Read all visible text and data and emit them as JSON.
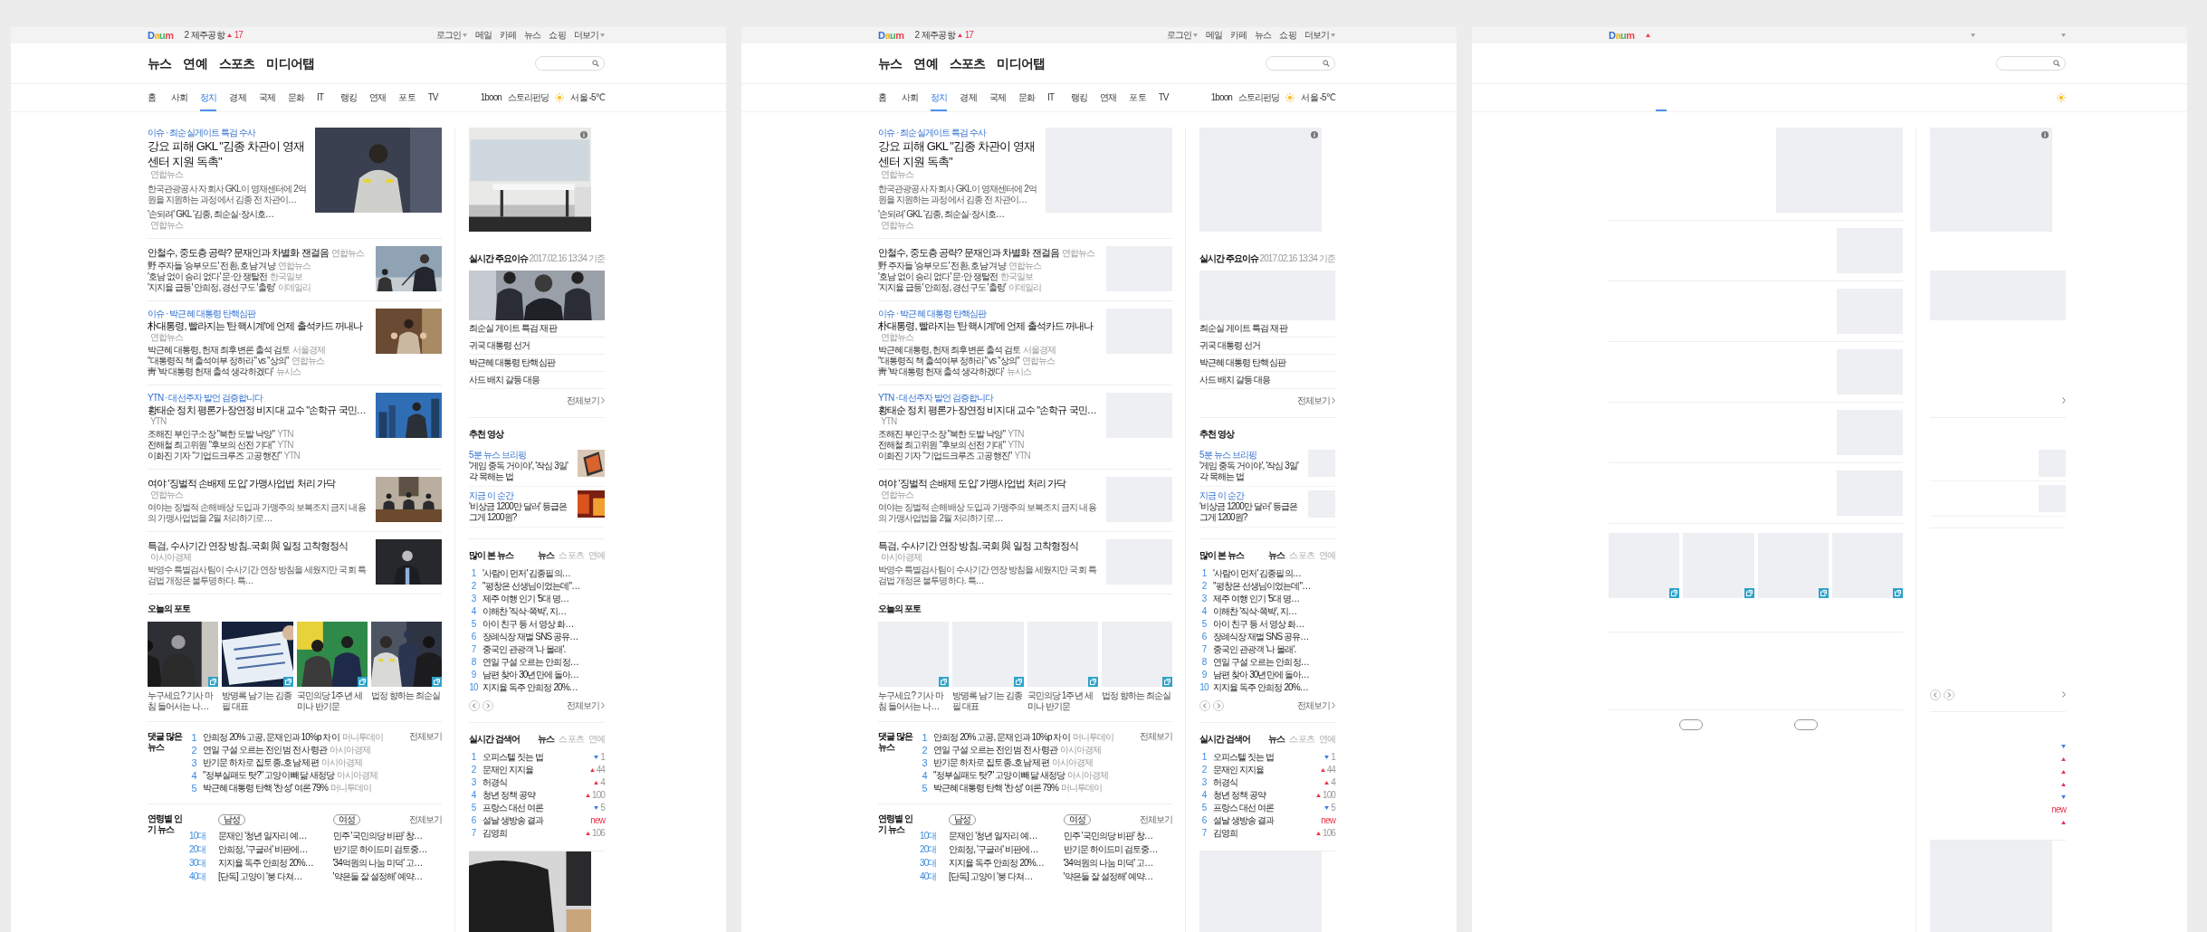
{
  "panels": [
    {
      "topbar": {
        "logo": "Daum",
        "hot": {
          "rank": "2",
          "keyword": "제주공항",
          "kind": "up",
          "change": "17"
        },
        "links": [
          {
            "label": "로그인",
            "dropdown": true
          },
          {
            "label": "메일",
            "dropdown": false
          },
          {
            "label": "카페",
            "dropdown": false
          },
          {
            "label": "뉴스",
            "dropdown": false
          },
          {
            "label": "쇼핑",
            "dropdown": false
          },
          {
            "label": "더보기",
            "dropdown": true
          }
        ]
      },
      "sections": [
        {
          "label": "뉴스"
        },
        {
          "label": "연예"
        },
        {
          "label": "스포츠"
        },
        {
          "label": "미디어탭"
        }
      ],
      "nav": [
        {
          "label": "홈",
          "selected": false
        },
        {
          "label": "사회",
          "selected": false
        },
        {
          "label": "정치",
          "selected": true
        },
        {
          "label": "경제",
          "selected": false
        },
        {
          "label": "국제",
          "selected": false
        },
        {
          "label": "문화",
          "selected": false
        },
        {
          "label": "IT",
          "selected": false
        },
        {
          "label": "랭킹",
          "selected": false
        },
        {
          "label": "연재",
          "selected": false
        },
        {
          "label": "포토",
          "selected": false
        },
        {
          "label": "TV",
          "selected": false
        }
      ],
      "nav_extra": {
        "links": [
          "1boon",
          "스토리펀딩"
        ],
        "weather": "서울 -5℃"
      },
      "articles": [
        {
          "kind": "lead",
          "tag": "이슈 · 최순실게이트 특검 수사",
          "headline": "강요 피해 GKL \"김종 차관이 영재센터 지원 독촉\"",
          "source": "연합뉴스",
          "summary": "한국관광공사 자회사 GKL이 영재센터에 2억원을 지원하는 과정에서 김종 전 차관이…",
          "related": [
            {
              "text": "'손되려' GKL '김종, 최순실·장시호…",
              "source": "연합뉴스"
            }
          ]
        },
        {
          "kind": "standard",
          "headline": "안철수, 중도층 공략? 문재인과 차별화 잰걸음",
          "source": "연합뉴스",
          "related": [
            {
              "text": "野 주자들 '승부모드' 전환, 호남 겨냥",
              "source": "연합뉴스"
            },
            {
              "text": "'호남 없이 승리 없다' 문·안 쟁탈전",
              "source": "한국일보"
            },
            {
              "text": "'지지율 급등' 안희정, 경선구도 '출렁'",
              "source": "이데일리"
            }
          ]
        },
        {
          "kind": "standard",
          "tag": "이슈 · 박근혜 대통령 탄핵심판",
          "headline": "朴대통령, 빨라지는 '탄핵시계'에 언제 출석카드 꺼내나",
          "source": "연합뉴스",
          "related": [
            {
              "text": "박근혜 대통령, 헌재 최후변론 출석 검토",
              "source": "서울경제"
            },
            {
              "text": "\"대통령직 책 출석여부 정하라\" vs \"상의\"",
              "source": "연합뉴스"
            },
            {
              "text": "靑 '박 대통령 헌재 출석 생각하겠다'",
              "source": "뉴시스"
            }
          ]
        },
        {
          "kind": "standard",
          "tag": "YTN · 대선주자 발언 검증합니다",
          "headline": "황태순 정치 평론가·장연정 비지대 교수 \"손학규 국민…",
          "source": "YTN",
          "related": [
            {
              "text": "조해진 부인구소장 \"북한 도발 낙양\"",
              "source": "YTN"
            },
            {
              "text": "전해철 최고위원 \"후보의 선전 기대\"",
              "source": "YTN"
            },
            {
              "text": "이화진 기자 \"기업드크루즈 고공행진\"",
              "source": "YTN"
            }
          ]
        },
        {
          "kind": "standard",
          "headline": "여야 '징벌적 손배제 도입' 가맹사업법 처리 가닥",
          "source": "연합뉴스",
          "summary": "여야는 징벌적 손해배상 도입과 가맹주의 보복조치 금지 내용의 가맹사업법을 2월 처리하기로…"
        },
        {
          "kind": "standard",
          "headline": "특검, 수사기간 연장 방침..국회 與 일정 고착형정식",
          "source": "아시아경제",
          "summary": "박영수 특별검사팀이 수사기간 연장 방침을 세웠지만 국회 특검법 개정은 불투명하다. 특…"
        }
      ],
      "photos": {
        "title": "오늘의 포토",
        "items": [
          {
            "kind": "picture",
            "caption": "누구세요? 기사 마침 들어서는 나…"
          },
          {
            "kind": "picture",
            "caption": "방명록 남기는 김종필 대표"
          },
          {
            "kind": "picture",
            "caption": "국민의당 1주년 세미나 반기문"
          },
          {
            "kind": "picture",
            "caption": "법정 향하는 최순실"
          }
        ]
      },
      "comments": {
        "title": "댓글 많은 뉴스",
        "more": "전체보기",
        "items": [
          {
            "rank": "1",
            "text": "안희정 20% 고공, 문재인과 10%p 차이",
            "source": "머니투데이"
          },
          {
            "rank": "2",
            "text": "연일 구설 오르는 전인범 전 사령관",
            "source": "아시아경제"
          },
          {
            "rank": "3",
            "text": "반기문 하차로 집토종..호남 제편",
            "source": "아시아경제"
          },
          {
            "rank": "4",
            "text": "\"정부실패도 탓?\" 고양이 빼닮 새정당",
            "source": "아시아경제"
          },
          {
            "rank": "5",
            "text": "박근혜 대통령 탄핵 '찬성' 여론 79%",
            "source": "머니투데이"
          }
        ]
      },
      "age_news": {
        "title": "연령별 인기 뉴스",
        "more": "전체보기",
        "tabs": [
          {
            "kind": "pill",
            "label": "남성"
          },
          {
            "kind": "pill",
            "label": "여성"
          }
        ],
        "rows": [
          {
            "age": "10대",
            "male": "문재인 '청년 일자리 예…",
            "female": "민주 '국민의당 비판' 창…"
          },
          {
            "age": "20대",
            "male": "안희정, '구글러' 비판에…",
            "female": "반기문 하이드미 검토중…"
          },
          {
            "age": "30대",
            "male": "지지율 독주 안희정 20%…",
            "female": "'34억원의 나눔 미덕' 고…"
          },
          {
            "age": "40대",
            "male": "[단독] 고양이 '붕 다쳐…",
            "female": "'약은둘 잘 설정해' 예약…"
          }
        ]
      },
      "sidebar": {
        "issue": {
          "title": "실시간 주요이슈",
          "time": "2017.02.16 13:34 기준",
          "items": [
            "최순실 게이트 특검 재판",
            "귀국 대통령 선거",
            "박근혜 대통령 탄핵심판",
            "사드 배치 갈등 대응"
          ],
          "more": "전체보기"
        },
        "recommend": {
          "title": "추천 영상",
          "items": [
            {
              "kind": "picture",
              "tag": "5분 뉴스 브리핑",
              "text": "'게임 중독 거이야', '작심 3일' 각 목해는 법"
            },
            {
              "kind": "picture",
              "tag": "지금 이 순간",
              "text": "'비상금 1200만 달러' 등급은 그게 1200원?"
            }
          ]
        },
        "most_viewed": {
          "title": "많이 본 뉴스",
          "tabs": [
            {
              "label": "뉴스",
              "selected": true
            },
            {
              "label": "스포츠",
              "selected": false
            },
            {
              "label": "연예",
              "selected": false
            }
          ],
          "items": [
            {
              "rank": "1",
              "text": "'사람이 먼저' 김종필의…"
            },
            {
              "rank": "2",
              "text": "\"평창은 선생님이었는데\"…"
            },
            {
              "rank": "3",
              "text": "제주 여행 인기 '5대 명…"
            },
            {
              "rank": "4",
              "text": "이해찬 '직삭·쪽박', 지…"
            },
            {
              "rank": "5",
              "text": "아이 친구 등 서 영상 화…"
            },
            {
              "rank": "6",
              "text": "장례식장 재벌 SNS 공유…"
            },
            {
              "rank": "7",
              "text": "중국인 관광객 '나 몰래'."
            },
            {
              "rank": "8",
              "text": "연일 구설 오르는 안희정…"
            },
            {
              "rank": "9",
              "text": "남편 찾아 30년만에 돌아…"
            },
            {
              "rank": "10",
              "text": "지지율 독주 안희정 20%…"
            }
          ],
          "more": "전체보기"
        },
        "realtime": {
          "title": "실시간 검색어",
          "tabs": [
            {
              "label": "뉴스",
              "selected": true
            },
            {
              "label": "스포츠",
              "selected": false
            },
            {
              "label": "연예",
              "selected": false
            }
          ],
          "items": [
            {
              "rank": "1",
              "keyword": "오피스텔 짓는 법",
              "kind": "down",
              "change": "1"
            },
            {
              "rank": "2",
              "keyword": "문재인 지지율",
              "kind": "up",
              "change": "44"
            },
            {
              "rank": "3",
              "keyword": "허경식",
              "kind": "up",
              "change": "4"
            },
            {
              "rank": "4",
              "keyword": "청년 정책 공약",
              "kind": "up",
              "change": "100"
            },
            {
              "rank": "5",
              "keyword": "프랑스 대선 여론",
              "kind": "down",
              "change": "5"
            },
            {
              "rank": "6",
              "keyword": "설날 생방송 결과",
              "kind": "new",
              "change": "new"
            },
            {
              "rank": "7",
              "keyword": "김영희",
              "kind": "up",
              "change": "106"
            }
          ]
        }
      }
    },
    {
      "kind": "placeholder",
      "topbar": {
        "logo": "Daum",
        "hot": {
          "rank": "2",
          "keyword": "제주공항",
          "kind": "up",
          "change": "17"
        },
        "links": [
          {
            "label": "로그인",
            "dropdown": true
          },
          {
            "label": "메일",
            "dropdown": false
          },
          {
            "label": "카페",
            "dropdown": false
          },
          {
            "label": "뉴스",
            "dropdown": false
          },
          {
            "label": "쇼핑",
            "dropdown": false
          },
          {
            "label": "더보기",
            "dropdown": true
          }
        ]
      },
      "sections": [
        {
          "label": "뉴스"
        },
        {
          "label": "연예"
        },
        {
          "label": "스포츠"
        },
        {
          "label": "미디어탭"
        }
      ],
      "nav": [
        {
          "label": "홈",
          "selected": false
        },
        {
          "label": "사회",
          "selected": false
        },
        {
          "label": "정치",
          "selected": true
        },
        {
          "label": "경제",
          "selected": false
        },
        {
          "label": "국제",
          "selected": false
        },
        {
          "label": "문화",
          "selected": false
        },
        {
          "label": "IT",
          "selected": false
        },
        {
          "label": "랭킹",
          "selected": false
        },
        {
          "label": "연재",
          "selected": false
        },
        {
          "label": "포토",
          "selected": false
        },
        {
          "label": "TV",
          "selected": false
        }
      ],
      "nav_extra": {
        "links": [
          "1boon",
          "스토리펀딩"
        ],
        "weather": "서울 -5℃"
      },
      "articles": [
        {
          "kind": "lead",
          "tag": "이슈 · 최순실게이트 특검 수사",
          "headline": "강요 피해 GKL \"김종 차관이 영재센터 지원 독촉\"",
          "source": "연합뉴스",
          "summary": "한국관광공사 자회사 GKL이 영재센터에 2억원을 지원하는 과정에서 김종 전 차관이…",
          "related": [
            {
              "text": "'손되려' GKL '김종, 최순실·장시호…",
              "source": "연합뉴스"
            }
          ]
        },
        {
          "kind": "standard",
          "headline": "안철수, 중도층 공략? 문재인과 차별화 잰걸음",
          "source": "연합뉴스",
          "related": [
            {
              "text": "野 주자들 '승부모드' 전환, 호남 겨냥",
              "source": "연합뉴스"
            },
            {
              "text": "'호남 없이 승리 없다' 문·안 쟁탈전",
              "source": "한국일보"
            },
            {
              "text": "'지지율 급등' 안희정, 경선구도 '출렁'",
              "source": "이데일리"
            }
          ]
        },
        {
          "kind": "standard",
          "tag": "이슈 · 박근혜 대통령 탄핵심판",
          "headline": "朴대통령, 빨라지는 '탄핵시계'에 언제 출석카드 꺼내나",
          "source": "연합뉴스",
          "related": [
            {
              "text": "박근혜 대통령, 헌재 최후변론 출석 검토",
              "source": "서울경제"
            },
            {
              "text": "\"대통령직 책 출석여부 정하라\" vs \"상의\"",
              "source": "연합뉴스"
            },
            {
              "text": "靑 '박 대통령 헌재 출석 생각하겠다'",
              "source": "뉴시스"
            }
          ]
        },
        {
          "kind": "standard",
          "tag": "YTN · 대선주자 발언 검증합니다",
          "headline": "황태순 정치 평론가·장연정 비지대 교수 \"손학규 국민…",
          "source": "YTN",
          "related": [
            {
              "text": "조해진 부인구소장 \"북한 도발 낙양\"",
              "source": "YTN"
            },
            {
              "text": "전해철 최고위원 \"후보의 선전 기대\"",
              "source": "YTN"
            },
            {
              "text": "이화진 기자 \"기업드크루즈 고공행진\"",
              "source": "YTN"
            }
          ]
        },
        {
          "kind": "standard",
          "headline": "여야 '징벌적 손배제 도입' 가맹사업법 처리 가닥",
          "source": "연합뉴스",
          "summary": "여야는 징벌적 손해배상 도입과 가맹주의 보복조치 금지 내용의 가맹사업법을 2월 처리하기로…"
        },
        {
          "kind": "standard",
          "headline": "특검, 수사기간 연장 방침..국회 與 일정 고착형정식",
          "source": "아시아경제",
          "summary": "박영수 특별검사팀이 수사기간 연장 방침을 세웠지만 국회 특검법 개정은 불투명하다. 특…"
        }
      ],
      "photos": {
        "title": "오늘의 포토",
        "items": [
          {
            "kind": "picture",
            "caption": "누구세요? 기사 마침 들어서는 나…"
          },
          {
            "kind": "picture",
            "caption": "방명록 남기는 김종필 대표"
          },
          {
            "kind": "picture",
            "caption": "국민의당 1주년 세미나 반기문"
          },
          {
            "kind": "picture",
            "caption": "법정 향하는 최순실"
          }
        ]
      },
      "comments": {
        "title": "댓글 많은 뉴스",
        "more": "전체보기",
        "items": [
          {
            "rank": "1",
            "text": "안희정 20% 고공, 문재인과 10%p 차이",
            "source": "머니투데이"
          },
          {
            "rank": "2",
            "text": "연일 구설 오르는 전인범 전 사령관",
            "source": "아시아경제"
          },
          {
            "rank": "3",
            "text": "반기문 하차로 집토종..호남 제편",
            "source": "아시아경제"
          },
          {
            "rank": "4",
            "text": "\"정부실패도 탓?\" 고양이 빼닮 새정당",
            "source": "아시아경제"
          },
          {
            "rank": "5",
            "text": "박근혜 대통령 탄핵 '찬성' 여론 79%",
            "source": "머니투데이"
          }
        ]
      },
      "age_news": {
        "title": "연령별 인기 뉴스",
        "more": "전체보기",
        "tabs": [
          {
            "kind": "pill",
            "label": "남성"
          },
          {
            "kind": "pill",
            "label": "여성"
          }
        ],
        "rows": [
          {
            "age": "10대",
            "male": "문재인 '청년 일자리 예…",
            "female": "민주 '국민의당 비판' 창…"
          },
          {
            "age": "20대",
            "male": "안희정, '구글러' 비판에…",
            "female": "반기문 하이드미 검토중…"
          },
          {
            "age": "30대",
            "male": "지지율 독주 안희정 20%…",
            "female": "'34억원의 나눔 미덕' 고…"
          },
          {
            "age": "40대",
            "male": "[단독] 고양이 '붕 다쳐…",
            "female": "'약은둘 잘 설정해' 예약…"
          }
        ]
      },
      "sidebar": {
        "issue": {
          "title": "실시간 주요이슈",
          "time": "2017.02.16 13:34 기준",
          "items": [
            "최순실 게이트 특검 재판",
            "귀국 대통령 선거",
            "박근혜 대통령 탄핵심판",
            "사드 배치 갈등 대응"
          ],
          "more": "전체보기"
        },
        "recommend": {
          "title": "추천 영상",
          "items": [
            {
              "kind": "picture",
              "tag": "5분 뉴스 브리핑",
              "text": "'게임 중독 거이야', '작심 3일' 각 목해는 법"
            },
            {
              "kind": "picture",
              "tag": "지금 이 순간",
              "text": "'비상금 1200만 달러' 등급은 그게 1200원?"
            }
          ]
        },
        "most_viewed": {
          "title": "많이 본 뉴스",
          "tabs": [
            {
              "label": "뉴스",
              "selected": true
            },
            {
              "label": "스포츠",
              "selected": false
            },
            {
              "label": "연예",
              "selected": false
            }
          ],
          "items": [
            {
              "rank": "1",
              "text": "'사람이 먼저' 김종필의…"
            },
            {
              "rank": "2",
              "text": "\"평창은 선생님이었는데\"…"
            },
            {
              "rank": "3",
              "text": "제주 여행 인기 '5대 명…"
            },
            {
              "rank": "4",
              "text": "이해찬 '직삭·쪽박', 지…"
            },
            {
              "rank": "5",
              "text": "아이 친구 등 서 영상 화…"
            },
            {
              "rank": "6",
              "text": "장례식장 재벌 SNS 공유…"
            },
            {
              "rank": "7",
              "text": "중국인 관광객 '나 몰래'."
            },
            {
              "rank": "8",
              "text": "연일 구설 오르는 안희정…"
            },
            {
              "rank": "9",
              "text": "남편 찾아 30년만에 돌아…"
            },
            {
              "rank": "10",
              "text": "지지율 독주 안희정 20%…"
            }
          ],
          "more": "전체보기"
        },
        "realtime": {
          "title": "실시간 검색어",
          "tabs": [
            {
              "label": "뉴스",
              "selected": true
            },
            {
              "label": "스포츠",
              "selected": false
            },
            {
              "label": "연예",
              "selected": false
            }
          ],
          "items": [
            {
              "rank": "1",
              "keyword": "오피스텔 짓는 법",
              "kind": "down",
              "change": "1"
            },
            {
              "rank": "2",
              "keyword": "문재인 지지율",
              "kind": "up",
              "change": "44"
            },
            {
              "rank": "3",
              "keyword": "허경식",
              "kind": "up",
              "change": "4"
            },
            {
              "rank": "4",
              "keyword": "청년 정책 공약",
              "kind": "up",
              "change": "100"
            },
            {
              "rank": "5",
              "keyword": "프랑스 대선 여론",
              "kind": "down",
              "change": "5"
            },
            {
              "rank": "6",
              "keyword": "설날 생방송 결과",
              "kind": "new",
              "change": "new"
            },
            {
              "rank": "7",
              "keyword": "김영희",
              "kind": "up",
              "change": "106"
            }
          ]
        }
      }
    },
    {
      "kind": "skeleton",
      "topbar": {
        "logo": "Daum",
        "hot": {
          "kind": "up"
        },
        "links": [
          {
            "dropdown": true
          },
          {
            "dropdown": true
          }
        ]
      },
      "nav": [
        {
          "selected": true
        }
      ],
      "articles": [
        {
          "kind": "lead"
        },
        {
          "kind": "standard"
        },
        {
          "kind": "standard"
        },
        {
          "kind": "standard"
        },
        {
          "kind": "standard"
        },
        {
          "kind": "standard"
        }
      ],
      "photos": {
        "items": [
          {
            "kind": "picture"
          },
          {
            "kind": "picture"
          },
          {
            "kind": "picture"
          },
          {
            "kind": "picture"
          }
        ]
      },
      "age_news": {
        "tabs": [
          {
            "kind": "pill"
          },
          {
            "kind": "pill"
          }
        ]
      },
      "sidebar": {
        "recommend": {
          "items": [
            {
              "kind": "picture"
            },
            {
              "kind": "picture"
            }
          ]
        },
        "realtime": {
          "items": [
            {
              "kind": "down"
            },
            {
              "kind": "up"
            },
            {
              "kind": "up"
            },
            {
              "kind": "up"
            },
            {
              "kind": "down"
            },
            {
              "kind": "new",
              "change": "new"
            },
            {
              "kind": "up"
            }
          ]
        }
      }
    }
  ]
}
